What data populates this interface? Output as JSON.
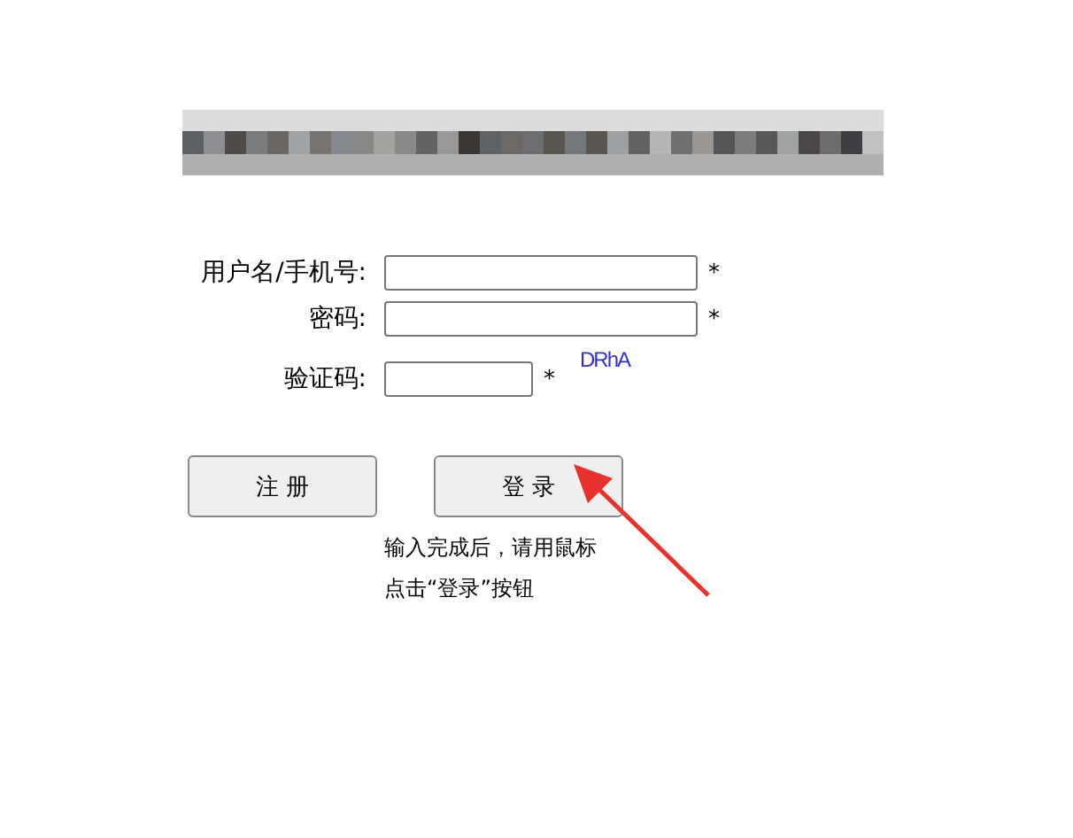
{
  "form": {
    "fields": [
      {
        "label": "用户名/手机号:",
        "required_mark": "*",
        "kind": "text"
      },
      {
        "label": "密码:",
        "required_mark": "*",
        "kind": "password"
      },
      {
        "label": "验证码:",
        "required_mark": "*",
        "kind": "captcha",
        "captcha": "DRhA"
      }
    ]
  },
  "buttons": [
    {
      "label": "注 册"
    },
    {
      "label": "登 录"
    }
  ],
  "hint": [
    "输入完成后，请用鼠标",
    "点击“登录”按钮"
  ]
}
